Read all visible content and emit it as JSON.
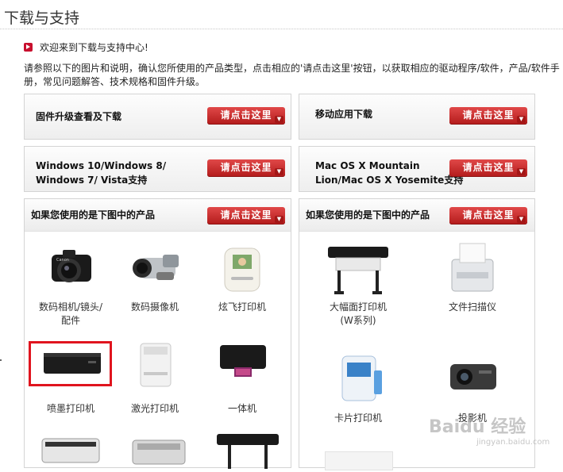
{
  "header": {
    "title": "下载与支持"
  },
  "welcome": {
    "text": "欢迎来到下载与支持中心!"
  },
  "intro": {
    "text": "请参照以下的图片和说明，确认您所使用的产品类型，点击相应的'请点击这里'按钮，以获取相应的驱动程序/软件，产品/软件手册，常见问题解答、技术规格和固件升级。"
  },
  "button_label": "请点击这里",
  "panels": {
    "firmware": {
      "label": "固件升级查看及下载"
    },
    "mobile": {
      "label": "移动应用下载"
    },
    "windows": {
      "line1": "Windows 10/Windows 8/",
      "line2": "Windows 7/ Vista支持"
    },
    "mac": {
      "line1": "Mac OS X Mountain",
      "line2": "Lion/Mac OS X Yosemite支持"
    }
  },
  "left_products": {
    "header": "如果您使用的是下图中的产品",
    "items": [
      {
        "label": "数码相机/镜头/",
        "label2": "配件",
        "icon": "camera-icon"
      },
      {
        "label": "数码摄像机",
        "label2": "",
        "icon": "camcorder-icon"
      },
      {
        "label": "炫飞打印机",
        "label2": "",
        "icon": "photo-printer-icon"
      },
      {
        "label": "喷墨打印机",
        "label2": "",
        "icon": "inkjet-printer-icon",
        "selected": true
      },
      {
        "label": "激光打印机",
        "label2": "",
        "icon": "laser-printer-icon"
      },
      {
        "label": "一体机",
        "label2": "",
        "icon": "all-in-one-printer-icon"
      }
    ]
  },
  "right_products": {
    "header": "如果您使用的是下图中的产品",
    "items": [
      {
        "label": "大幅面打印机",
        "label2": "(W系列)",
        "icon": "large-format-printer-icon"
      },
      {
        "label": "文件扫描仪",
        "label2": "",
        "icon": "document-scanner-icon"
      },
      {
        "label": "卡片打印机",
        "label2": "",
        "icon": "card-printer-icon"
      },
      {
        "label": "投影机",
        "label2": "",
        "icon": "projector-icon"
      }
    ]
  },
  "watermark": {
    "text": "Baidu 经验",
    "sub": "jingyan.baidu.com"
  }
}
